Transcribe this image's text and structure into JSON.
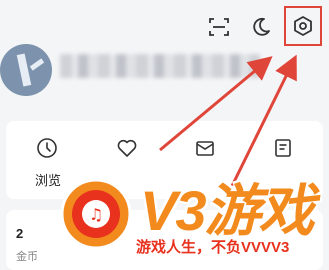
{
  "header": {
    "scan_icon": "scan-icon",
    "moon_icon": "moon-icon",
    "settings_icon": "settings-icon"
  },
  "profile": {
    "avatar": "avatar"
  },
  "menu": {
    "items": [
      {
        "label": "浏览",
        "icon": "clock-icon"
      },
      {
        "label": "",
        "icon": "heart-icon"
      },
      {
        "label": "",
        "icon": "message-icon"
      },
      {
        "label": "",
        "icon": "document-icon"
      }
    ]
  },
  "stats": {
    "value": "2",
    "label": "金币"
  },
  "watermark": {
    "title": "V3游戏",
    "subtitle": "游戏人生，不负VVVV3"
  },
  "colors": {
    "annotation": "#e0453a",
    "watermark_orange": "#f28a1e",
    "watermark_red": "#e8321e"
  }
}
